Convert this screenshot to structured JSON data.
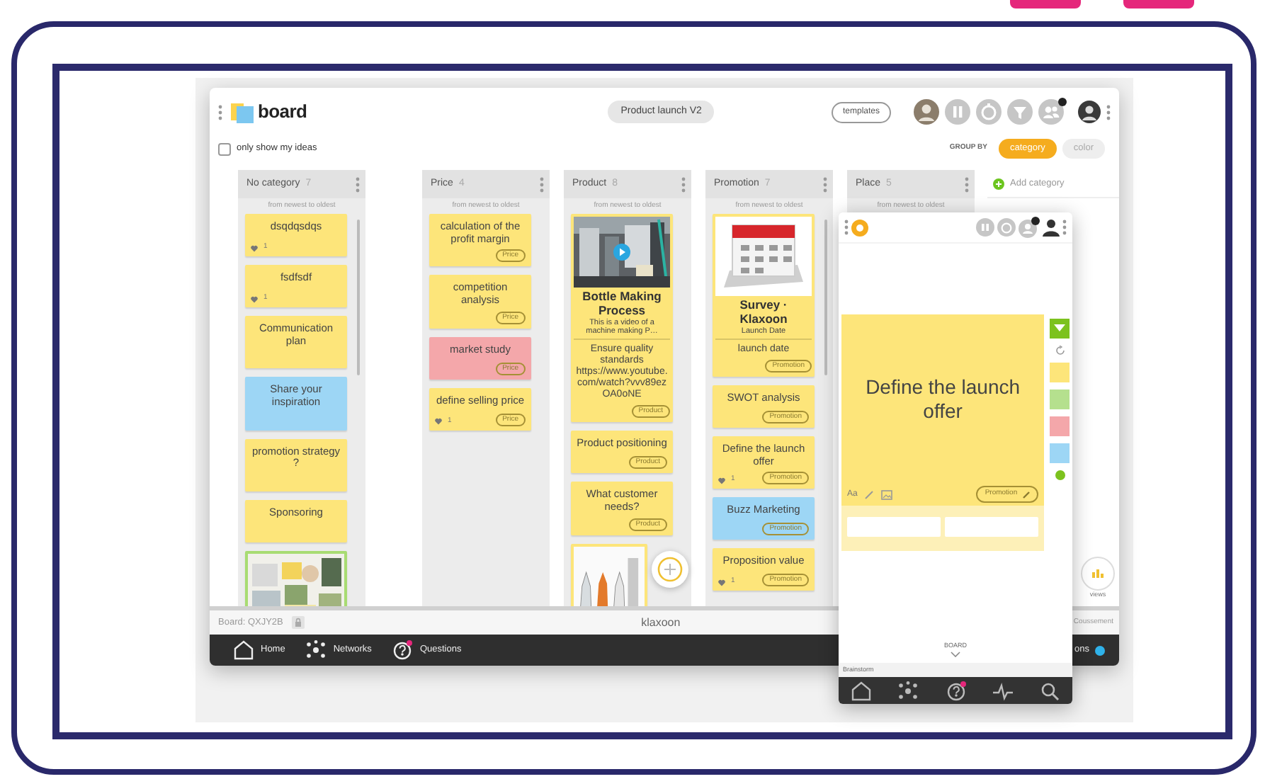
{
  "header": {
    "app_name": "board",
    "board_title": "Product launch V2",
    "templates_button": "templates"
  },
  "filter": {
    "label": "only show my ideas",
    "checked": false
  },
  "group_by": {
    "label": "GROUP BY",
    "options": [
      {
        "label": "category",
        "selected": true
      },
      {
        "label": "color",
        "selected": false
      }
    ]
  },
  "columns": [
    {
      "title": "No category",
      "count": "7",
      "sort": "from newest to oldest",
      "cards": [
        {
          "kind": "note",
          "text": "dsqdqsdqs",
          "color": "#fde57a",
          "likes": "1"
        },
        {
          "kind": "note",
          "text": "fsdfsdf",
          "color": "#fde57a",
          "likes": "1"
        },
        {
          "kind": "note",
          "text": "Communication plan",
          "color": "#fde57a"
        },
        {
          "kind": "note",
          "text": "Share your inspiration",
          "color": "#9dd6f5"
        },
        {
          "kind": "note",
          "text": "promotion strategy ?",
          "color": "#fde57a"
        },
        {
          "kind": "note",
          "text": "Sponsoring",
          "color": "#fde57a"
        },
        {
          "kind": "picture",
          "color": "#a8dc72"
        }
      ]
    },
    {
      "title": "Price",
      "count": "4",
      "sort": "from newest to oldest",
      "cards": [
        {
          "kind": "note",
          "text": "calculation of the profit margin",
          "color": "#fde57a",
          "tag": "Price"
        },
        {
          "kind": "note",
          "text": "competition analysis",
          "color": "#fde57a",
          "tag": "Price"
        },
        {
          "kind": "note",
          "text": "market study",
          "color": "#f4a7aa",
          "tag": "Price"
        },
        {
          "kind": "note",
          "text": "define selling price",
          "color": "#fde57a",
          "tag": "Price",
          "likes": "1"
        }
      ]
    },
    {
      "title": "Product",
      "count": "8",
      "sort": "from newest to oldest",
      "cards": [
        {
          "kind": "video",
          "title": "Bottle Making Process",
          "description": "This is a video of a machine making P…",
          "text": "Ensure quality standards https://www.youtube.com/watch?vvv89ez OA0oNE",
          "color": "#fde57a",
          "tag": "Product"
        },
        {
          "kind": "note",
          "text": "Product positioning",
          "color": "#fde57a",
          "tag": "Product"
        },
        {
          "kind": "note",
          "text": "What customer needs?",
          "color": "#fde57a",
          "tag": "Product"
        },
        {
          "kind": "picture",
          "color": "#fde57a"
        }
      ]
    },
    {
      "title": "Promotion",
      "count": "7",
      "sort": "from newest to oldest",
      "cards": [
        {
          "kind": "survey",
          "title": "Survey · Klaxoon",
          "description": "Launch Date",
          "text": "launch date",
          "color": "#fde57a",
          "tag": "Promotion"
        },
        {
          "kind": "note",
          "text": "SWOT analysis",
          "color": "#fde57a",
          "tag": "Promotion"
        },
        {
          "kind": "note",
          "text": "Define the launch offer",
          "color": "#fde57a",
          "tag": "Promotion",
          "likes": "1"
        },
        {
          "kind": "note",
          "text": "Buzz Marketing",
          "color": "#9dd6f5",
          "tag": "Promotion"
        },
        {
          "kind": "note",
          "text": "Proposition value",
          "color": "#fde57a",
          "tag": "Promotion",
          "likes": "1"
        }
      ]
    },
    {
      "title": "Place",
      "count": "5",
      "sort": "from newest to oldest"
    }
  ],
  "add_category": "Add category",
  "views_label": "views",
  "footer": {
    "board_code": "Board: QXJY2B",
    "brand": "klaxoon",
    "user": "Coussement"
  },
  "nav": [
    {
      "label": "Home"
    },
    {
      "label": "Networks"
    },
    {
      "label": "Questions"
    }
  ],
  "nav_cut_label": "ons",
  "mobile": {
    "card_text": "Define the launch offer",
    "format_button": "Aa",
    "tag": "Promotion",
    "palette": [
      {
        "kind": "swatch",
        "color": "#fde57a"
      },
      {
        "kind": "swatch",
        "color": "#b5e08e"
      },
      {
        "kind": "swatch",
        "color": "#f4a7aa"
      },
      {
        "kind": "swatch",
        "color": "#9dd6f5"
      },
      {
        "kind": "dot",
        "color": "#7cc21e"
      }
    ],
    "board_label": "BOARD",
    "session_label": "Brainstorm"
  }
}
